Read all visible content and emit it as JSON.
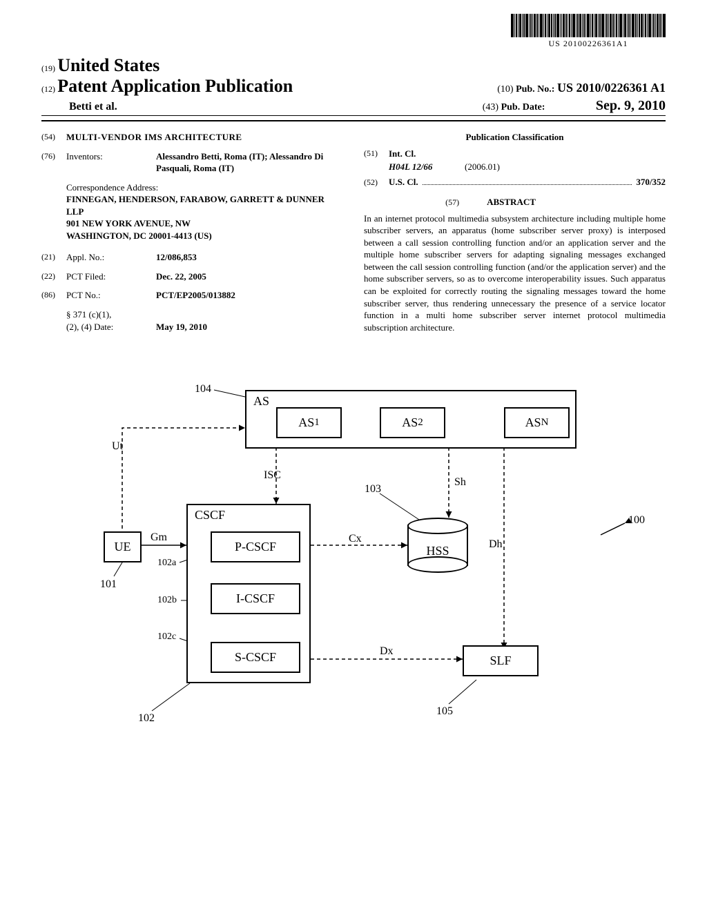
{
  "barcode_text": "US 20100226361A1",
  "header": {
    "code19": "(19)",
    "country": "United States",
    "code12": "(12)",
    "pub_title": "Patent Application Publication",
    "author": "Betti et al.",
    "pubno_code": "(10)",
    "pubno_label": "Pub. No.:",
    "pubno_value": "US 2010/0226361 A1",
    "pubdate_code": "(43)",
    "pubdate_label": "Pub. Date:",
    "pubdate_value": "Sep. 9, 2010"
  },
  "left": {
    "title_code": "(54)",
    "title": "MULTI-VENDOR IMS ARCHITECTURE",
    "inventors_code": "(76)",
    "inventors_label": "Inventors:",
    "inventors_value": "Alessandro Betti, Roma (IT); Alessandro Di Pasquali, Roma (IT)",
    "corr_label": "Correspondence Address:",
    "corr_body": "FINNEGAN, HENDERSON, FARABOW, GARRETT & DUNNER\nLLP\n901 NEW YORK AVENUE, NW\nWASHINGTON, DC 20001-4413 (US)",
    "appl_code": "(21)",
    "appl_label": "Appl. No.:",
    "appl_value": "12/086,853",
    "pct_filed_code": "(22)",
    "pct_filed_label": "PCT Filed:",
    "pct_filed_value": "Dec. 22, 2005",
    "pct_no_code": "(86)",
    "pct_no_label": "PCT No.:",
    "pct_no_value": "PCT/EP2005/013882",
    "sec371_label": "§ 371 (c)(1),\n(2), (4) Date:",
    "sec371_value": "May 19, 2010"
  },
  "right": {
    "class_heading": "Publication Classification",
    "intcl_code": "(51)",
    "intcl_label": "Int. Cl.",
    "intcl_class": "H04L 12/66",
    "intcl_date": "(2006.01)",
    "uscl_code": "(52)",
    "uscl_label": "U.S. Cl.",
    "uscl_value": "370/352",
    "abstract_code": "(57)",
    "abstract_heading": "ABSTRACT",
    "abstract_body": "In an internet protocol multimedia subsystem architecture including multiple home subscriber servers, an apparatus (home subscriber server proxy) is interposed between a call session controlling function and/or an application server and the multiple home subscriber servers for adapting signaling messages exchanged between the call session controlling function (and/or the application server) and the home subscriber servers, so as to overcome interoperability issues. Such apparatus can be exploited for correctly routing the signaling messages toward the home subscriber server, thus rendering unnecessary the presence of a service locator function in a multi home subscriber server internet protocol multimedia subscription architecture."
  },
  "diagram": {
    "ref_100": "100",
    "ref_101": "101",
    "ref_102": "102",
    "ref_102a": "102a",
    "ref_102b": "102b",
    "ref_102c": "102c",
    "ref_103": "103",
    "ref_104": "104",
    "ref_105": "105",
    "UE": "UE",
    "AS": "AS",
    "AS1": "AS",
    "AS1_sub": "1",
    "AS2": "AS",
    "AS2_sub": "2",
    "ASN": "AS",
    "ASN_sub": "N",
    "CSCF": "CSCF",
    "PCSCF": "P-CSCF",
    "ICSCF": "I-CSCF",
    "SCSCF": "S-CSCF",
    "HSS": "HSS",
    "SLF": "SLF",
    "Ut": "Ut",
    "ISC": "ISC",
    "Sh": "Sh",
    "Gm": "Gm",
    "Cx": "Cx",
    "Dh": "Dh",
    "Dx": "Dx"
  }
}
